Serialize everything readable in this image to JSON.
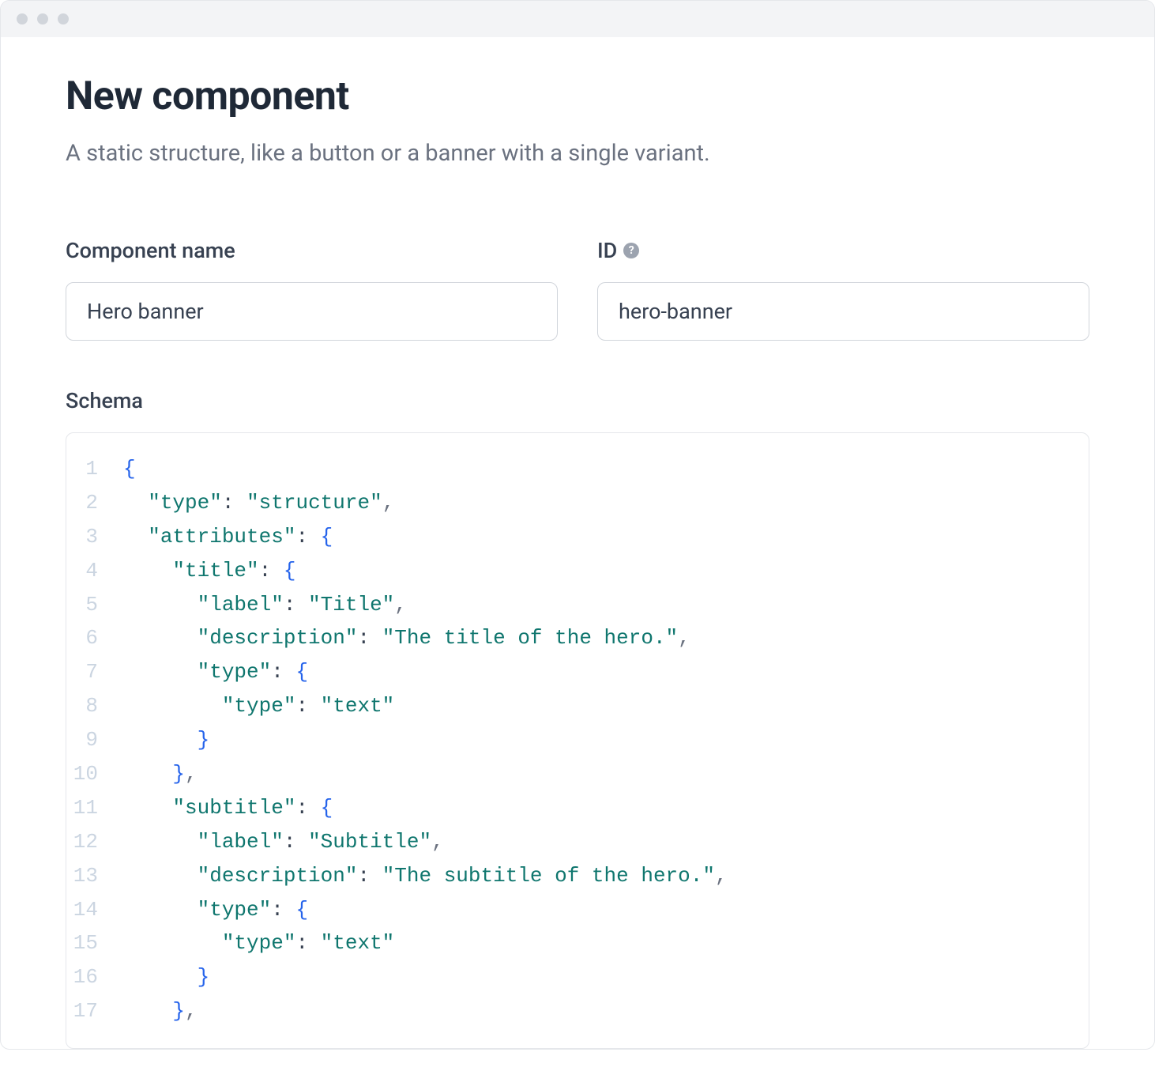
{
  "page": {
    "title": "New component",
    "subtitle": "A static structure, like a button or a banner with a single variant."
  },
  "form": {
    "name_label": "Component name",
    "name_value": "Hero banner",
    "id_label": "ID",
    "id_value": "hero-banner",
    "schema_label": "Schema"
  },
  "schema_lines": [
    {
      "n": "1",
      "indent": 0,
      "tokens": [
        {
          "t": "{",
          "c": "brace"
        }
      ]
    },
    {
      "n": "2",
      "indent": 1,
      "tokens": [
        {
          "t": "\"type\"",
          "c": "key"
        },
        {
          "t": ": ",
          "c": "punct"
        },
        {
          "t": "\"structure\"",
          "c": "string"
        },
        {
          "t": ",",
          "c": "comma"
        }
      ]
    },
    {
      "n": "3",
      "indent": 1,
      "tokens": [
        {
          "t": "\"attributes\"",
          "c": "key"
        },
        {
          "t": ": ",
          "c": "punct"
        },
        {
          "t": "{",
          "c": "brace"
        }
      ]
    },
    {
      "n": "4",
      "indent": 2,
      "tokens": [
        {
          "t": "\"title\"",
          "c": "key"
        },
        {
          "t": ": ",
          "c": "punct"
        },
        {
          "t": "{",
          "c": "brace"
        }
      ]
    },
    {
      "n": "5",
      "indent": 3,
      "tokens": [
        {
          "t": "\"label\"",
          "c": "key"
        },
        {
          "t": ": ",
          "c": "punct"
        },
        {
          "t": "\"Title\"",
          "c": "string"
        },
        {
          "t": ",",
          "c": "comma"
        }
      ]
    },
    {
      "n": "6",
      "indent": 3,
      "tokens": [
        {
          "t": "\"description\"",
          "c": "key"
        },
        {
          "t": ": ",
          "c": "punct"
        },
        {
          "t": "\"The title of the hero.\"",
          "c": "string"
        },
        {
          "t": ",",
          "c": "comma"
        }
      ]
    },
    {
      "n": "7",
      "indent": 3,
      "tokens": [
        {
          "t": "\"type\"",
          "c": "key"
        },
        {
          "t": ": ",
          "c": "punct"
        },
        {
          "t": "{",
          "c": "brace"
        }
      ]
    },
    {
      "n": "8",
      "indent": 4,
      "tokens": [
        {
          "t": "\"type\"",
          "c": "key"
        },
        {
          "t": ": ",
          "c": "punct"
        },
        {
          "t": "\"text\"",
          "c": "string"
        }
      ]
    },
    {
      "n": "9",
      "indent": 3,
      "tokens": [
        {
          "t": "}",
          "c": "brace"
        }
      ]
    },
    {
      "n": "10",
      "indent": 2,
      "tokens": [
        {
          "t": "}",
          "c": "brace"
        },
        {
          "t": ",",
          "c": "comma"
        }
      ]
    },
    {
      "n": "11",
      "indent": 2,
      "tokens": [
        {
          "t": "\"subtitle\"",
          "c": "key"
        },
        {
          "t": ": ",
          "c": "punct"
        },
        {
          "t": "{",
          "c": "brace"
        }
      ]
    },
    {
      "n": "12",
      "indent": 3,
      "tokens": [
        {
          "t": "\"label\"",
          "c": "key"
        },
        {
          "t": ": ",
          "c": "punct"
        },
        {
          "t": "\"Subtitle\"",
          "c": "string"
        },
        {
          "t": ",",
          "c": "comma"
        }
      ]
    },
    {
      "n": "13",
      "indent": 3,
      "tokens": [
        {
          "t": "\"description\"",
          "c": "key"
        },
        {
          "t": ": ",
          "c": "punct"
        },
        {
          "t": "\"The subtitle of the hero.\"",
          "c": "string"
        },
        {
          "t": ",",
          "c": "comma"
        }
      ]
    },
    {
      "n": "14",
      "indent": 3,
      "tokens": [
        {
          "t": "\"type\"",
          "c": "key"
        },
        {
          "t": ": ",
          "c": "punct"
        },
        {
          "t": "{",
          "c": "brace"
        }
      ]
    },
    {
      "n": "15",
      "indent": 4,
      "tokens": [
        {
          "t": "\"type\"",
          "c": "key"
        },
        {
          "t": ": ",
          "c": "punct"
        },
        {
          "t": "\"text\"",
          "c": "string"
        }
      ]
    },
    {
      "n": "16",
      "indent": 3,
      "tokens": [
        {
          "t": "}",
          "c": "brace"
        }
      ]
    },
    {
      "n": "17",
      "indent": 2,
      "tokens": [
        {
          "t": "}",
          "c": "brace"
        },
        {
          "t": ",",
          "c": "comma"
        }
      ]
    }
  ]
}
